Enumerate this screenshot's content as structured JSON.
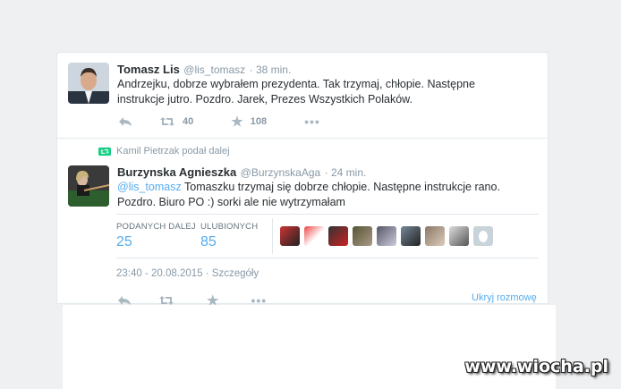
{
  "tweet1": {
    "name": "Tomasz Lis",
    "handle": "@lis_tomasz",
    "time": "· 38 min.",
    "text_line1": "Andrzejku, dobrze wybrałem prezydenta. Tak trzymaj, chłopie. Następne",
    "text_line2": "instrukcje jutro. Pozdro. Jarek, Prezes Wszystkich Polaków.",
    "retweets": "40",
    "favorites": "108"
  },
  "retweet_context": "Kamil Pietrzak podał dalej",
  "tweet2": {
    "name": "Burzynska Agnieszka",
    "handle": "@BurzynskaAga",
    "time": "· 24 min.",
    "mention": "@lis_tomasz",
    "text_line1": "Tomaszku trzymaj się dobrze chłopie. Następne instrukcje rano.",
    "text_line2": "Pozdro. Biuro PO :) sorki ale nie wytrzymałam",
    "stats": {
      "retweets_label": "PODANYCH DALEJ",
      "retweets_value": "25",
      "favorites_label": "ULUBIONYCH",
      "favorites_value": "85"
    },
    "timestamp": "23:40 - 20.08.2015",
    "details": "Szczegóły",
    "hide_conversation": "Ukryj rozmowę"
  },
  "watermark": "www.wiocha.pl",
  "colors": {
    "link": "#55acee",
    "retweet_green": "#19cf86",
    "icon_gray": "#aab8c2"
  }
}
